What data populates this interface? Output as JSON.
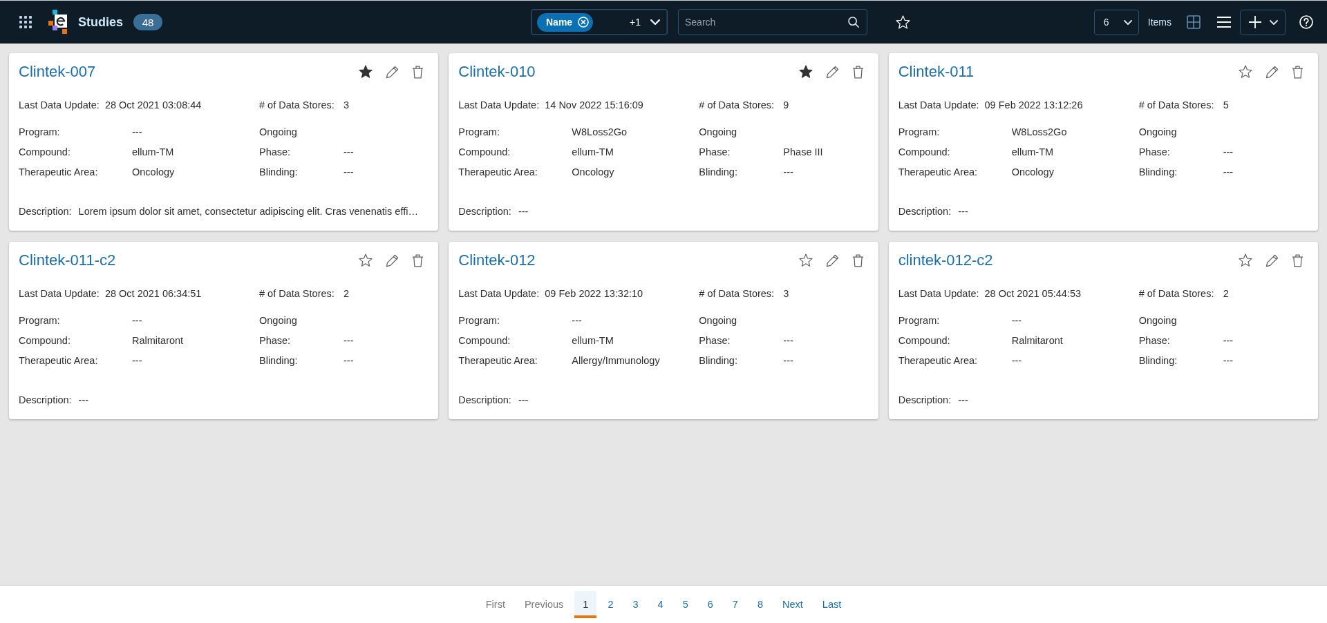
{
  "header": {
    "title": "Studies",
    "count": "48",
    "filter": {
      "chips": [
        {
          "label": "Name"
        }
      ],
      "more": "+1"
    },
    "search": {
      "placeholder": "Search"
    },
    "page_size": {
      "value": "6",
      "label": "Items"
    },
    "views": [
      {
        "kind": "grid",
        "selected": true
      },
      {
        "kind": "list",
        "selected": false
      }
    ]
  },
  "studies": [
    {
      "name": "Clintek-007",
      "favorite": true,
      "last_update": {
        "label": "Last Data Update:",
        "value": "28 Oct 2021 03:08:44"
      },
      "data_stores": {
        "label": "# of Data Stores:",
        "value": "3"
      },
      "details": [
        {
          "kind": "field",
          "label": "Program:",
          "value": "---"
        },
        {
          "kind": "status",
          "value": "Ongoing"
        },
        {
          "kind": "field",
          "label": "Compound:",
          "value": "ellum-TM"
        },
        {
          "kind": "field",
          "label": "Phase:",
          "value": "---"
        },
        {
          "kind": "field",
          "label": "Therapeutic Area:",
          "value": "Oncology"
        },
        {
          "kind": "field",
          "label": "Blinding:",
          "value": "---"
        }
      ],
      "description": {
        "label": "Description:",
        "value": "Lorem ipsum dolor sit amet, consectetur adipiscing elit. Cras venenatis effi…"
      }
    },
    {
      "name": "Clintek-010",
      "favorite": true,
      "last_update": {
        "label": "Last Data Update:",
        "value": "14 Nov 2022 15:16:09"
      },
      "data_stores": {
        "label": "# of Data Stores:",
        "value": "9"
      },
      "details": [
        {
          "kind": "field",
          "label": "Program:",
          "value": "W8Loss2Go"
        },
        {
          "kind": "status",
          "value": "Ongoing"
        },
        {
          "kind": "field",
          "label": "Compound:",
          "value": "ellum-TM"
        },
        {
          "kind": "field",
          "label": "Phase:",
          "value": "Phase III"
        },
        {
          "kind": "field",
          "label": "Therapeutic Area:",
          "value": "Oncology"
        },
        {
          "kind": "field",
          "label": "Blinding:",
          "value": "---"
        }
      ],
      "description": {
        "label": "Description:",
        "value": "---"
      }
    },
    {
      "name": "Clintek-011",
      "favorite": false,
      "last_update": {
        "label": "Last Data Update:",
        "value": "09 Feb 2022 13:12:26"
      },
      "data_stores": {
        "label": "# of Data Stores:",
        "value": "5"
      },
      "details": [
        {
          "kind": "field",
          "label": "Program:",
          "value": "W8Loss2Go"
        },
        {
          "kind": "status",
          "value": "Ongoing"
        },
        {
          "kind": "field",
          "label": "Compound:",
          "value": "ellum-TM"
        },
        {
          "kind": "field",
          "label": "Phase:",
          "value": "---"
        },
        {
          "kind": "field",
          "label": "Therapeutic Area:",
          "value": "Oncology"
        },
        {
          "kind": "field",
          "label": "Blinding:",
          "value": "---"
        }
      ],
      "description": {
        "label": "Description:",
        "value": "---"
      }
    },
    {
      "name": "Clintek-011-c2",
      "favorite": false,
      "last_update": {
        "label": "Last Data Update:",
        "value": "28 Oct 2021 06:34:51"
      },
      "data_stores": {
        "label": "# of Data Stores:",
        "value": "2"
      },
      "details": [
        {
          "kind": "field",
          "label": "Program:",
          "value": "---"
        },
        {
          "kind": "status",
          "value": "Ongoing"
        },
        {
          "kind": "field",
          "label": "Compound:",
          "value": "Ralmitaront"
        },
        {
          "kind": "field",
          "label": "Phase:",
          "value": "---"
        },
        {
          "kind": "field",
          "label": "Therapeutic Area:",
          "value": "---"
        },
        {
          "kind": "field",
          "label": "Blinding:",
          "value": "---"
        }
      ],
      "description": {
        "label": "Description:",
        "value": "---"
      }
    },
    {
      "name": "Clintek-012",
      "favorite": false,
      "last_update": {
        "label": "Last Data Update:",
        "value": "09 Feb 2022 13:32:10"
      },
      "data_stores": {
        "label": "# of Data Stores:",
        "value": "3"
      },
      "details": [
        {
          "kind": "field",
          "label": "Program:",
          "value": "---"
        },
        {
          "kind": "status",
          "value": "Ongoing"
        },
        {
          "kind": "field",
          "label": "Compound:",
          "value": "ellum-TM"
        },
        {
          "kind": "field",
          "label": "Phase:",
          "value": "---"
        },
        {
          "kind": "field",
          "label": "Therapeutic Area:",
          "value": "Allergy/Immunology"
        },
        {
          "kind": "field",
          "label": "Blinding:",
          "value": "---"
        }
      ],
      "description": {
        "label": "Description:",
        "value": "---"
      }
    },
    {
      "name": "clintek-012-c2",
      "favorite": false,
      "last_update": {
        "label": "Last Data Update:",
        "value": "28 Oct 2021 05:44:53"
      },
      "data_stores": {
        "label": "# of Data Stores:",
        "value": "2"
      },
      "details": [
        {
          "kind": "field",
          "label": "Program:",
          "value": "---"
        },
        {
          "kind": "status",
          "value": "Ongoing"
        },
        {
          "kind": "field",
          "label": "Compound:",
          "value": "Ralmitaront"
        },
        {
          "kind": "field",
          "label": "Phase:",
          "value": "---"
        },
        {
          "kind": "field",
          "label": "Therapeutic Area:",
          "value": "---"
        },
        {
          "kind": "field",
          "label": "Blinding:",
          "value": "---"
        }
      ],
      "description": {
        "label": "Description:",
        "value": "---"
      }
    }
  ],
  "pagination": [
    {
      "label": "First",
      "selected": false,
      "disabled": true
    },
    {
      "label": "Previous",
      "selected": false,
      "disabled": true
    },
    {
      "label": "1",
      "selected": true,
      "disabled": false
    },
    {
      "label": "2",
      "selected": false,
      "disabled": false
    },
    {
      "label": "3",
      "selected": false,
      "disabled": false
    },
    {
      "label": "4",
      "selected": false,
      "disabled": false
    },
    {
      "label": "5",
      "selected": false,
      "disabled": false
    },
    {
      "label": "6",
      "selected": false,
      "disabled": false
    },
    {
      "label": "7",
      "selected": false,
      "disabled": false
    },
    {
      "label": "8",
      "selected": false,
      "disabled": false
    },
    {
      "label": "Next",
      "selected": false,
      "disabled": false
    },
    {
      "label": "Last",
      "selected": false,
      "disabled": false
    }
  ]
}
